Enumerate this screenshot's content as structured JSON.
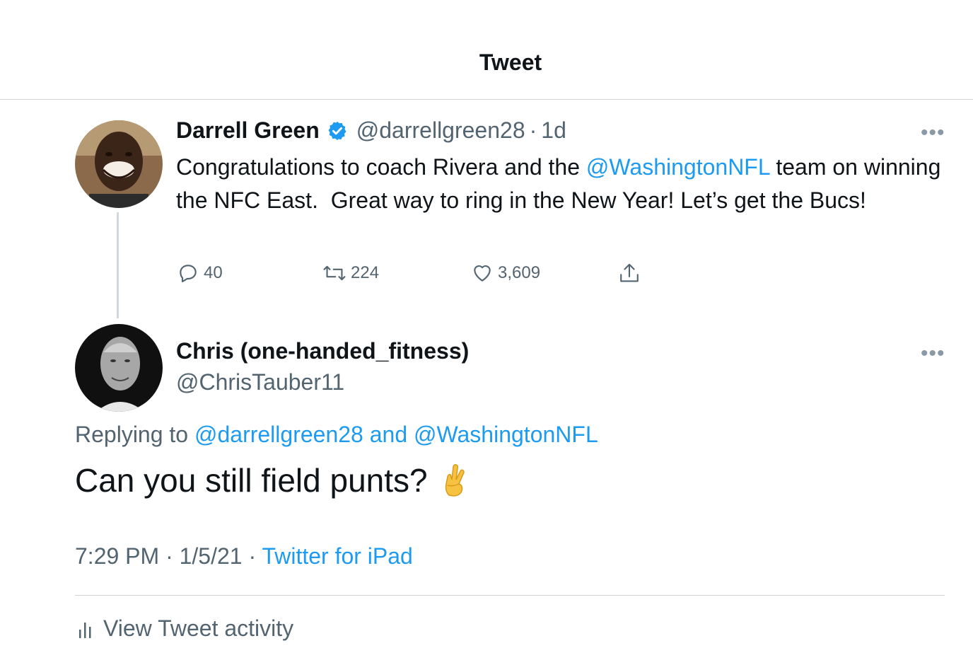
{
  "header": {
    "title": "Tweet"
  },
  "tweet": {
    "author_name": "Darrell Green",
    "verified_icon": "verified-badge-icon",
    "handle": "@darrellgreen28",
    "separator": "·",
    "age": "1d",
    "text_part1": "Congratulations to coach Rivera and the ",
    "mention": "@WashingtonNFL",
    "text_part2": " team on winning the NFC East.  Great way to ring in the New Year! Let’s get the Bucs!",
    "more_label": "•••",
    "actions": {
      "replies": "40",
      "retweets": "224",
      "likes": "3,609"
    },
    "icons": {
      "reply": "reply-icon",
      "retweet": "retweet-icon",
      "like": "heart-icon",
      "share": "share-icon"
    }
  },
  "reply": {
    "author_name": "Chris (one-handed_fitness)",
    "handle": "@ChrisTauber11",
    "more_label": "•••",
    "replying_to_label": "Replying to ",
    "replying_to_users": "@darrellgreen28 and @WashingtonNFL",
    "text": "Can you still field punts?",
    "emoji_icon": "crossed-fingers-emoji",
    "time": "7:29 PM",
    "dot": "·",
    "date": "1/5/21",
    "source": "Twitter for iPad"
  },
  "footer": {
    "activity_label": "View Tweet activity",
    "activity_icon": "bar-chart-icon"
  },
  "colors": {
    "link": "#1d9bf0",
    "muted": "#536471",
    "text": "#0f1419",
    "divider": "#cfd4d8"
  }
}
